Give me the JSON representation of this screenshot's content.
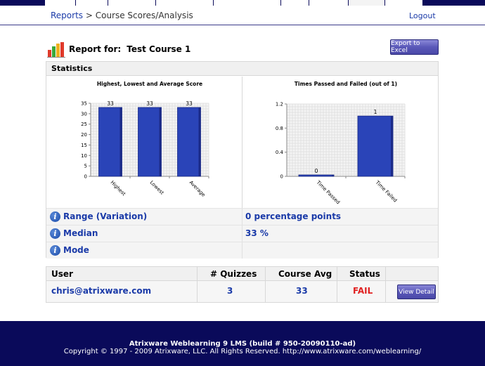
{
  "breadcrumb": {
    "link": "Reports",
    "separator": " > ",
    "current": "Course Scores/Analysis"
  },
  "logout_label": "Logout",
  "report": {
    "prefix": "Report for:",
    "course": "Test Course 1"
  },
  "export_button_label": "Export to Excel",
  "stats": {
    "header": "Statistics",
    "rows": [
      {
        "label": "Range (Variation)",
        "value": "0 percentage points"
      },
      {
        "label": "Median",
        "value": "33 %"
      },
      {
        "label": "Mode",
        "value": ""
      }
    ]
  },
  "chart_data": [
    {
      "type": "bar",
      "title": "Highest, Lowest and Average Score",
      "categories": [
        "Highest",
        "Lowest",
        "Average"
      ],
      "values": [
        33,
        33,
        33
      ],
      "data_labels": [
        "33",
        "33",
        "33"
      ],
      "ylim": [
        0,
        35
      ],
      "yticks": [
        0,
        5,
        10,
        15,
        20,
        25,
        30,
        35
      ],
      "grid": true,
      "bar_color": "#2a44b8"
    },
    {
      "type": "bar",
      "title": "Times Passed and Failed (out of 1)",
      "categories": [
        "Time Passed",
        "Time Failed"
      ],
      "values": [
        0,
        1
      ],
      "data_labels": [
        "0",
        "1"
      ],
      "ylim": [
        0,
        1.2
      ],
      "yticks": [
        0,
        0.4,
        0.8,
        1.2
      ],
      "grid": true,
      "bar_color": "#2a44b8"
    }
  ],
  "user_table": {
    "headers": [
      "User",
      "# Quizzes",
      "Course Avg",
      "Status"
    ],
    "row": {
      "user": "chris@atrixware.com",
      "quizzes": "3",
      "course_avg": "33",
      "status": "FAIL"
    },
    "view_button_label": "View Detail",
    "status_color": "#e02020"
  },
  "footer": {
    "line1": "Atrixware Weblearning 9 LMS (build # 950-20090110-ad)",
    "line2": "Copyright © 1997 - 2009 Atrixware, LLC. All Rights Reserved. http://www.atrixware.com/weblearning/"
  },
  "colors": {
    "navy": "#0a0a5a",
    "link": "#1a3aa8"
  }
}
